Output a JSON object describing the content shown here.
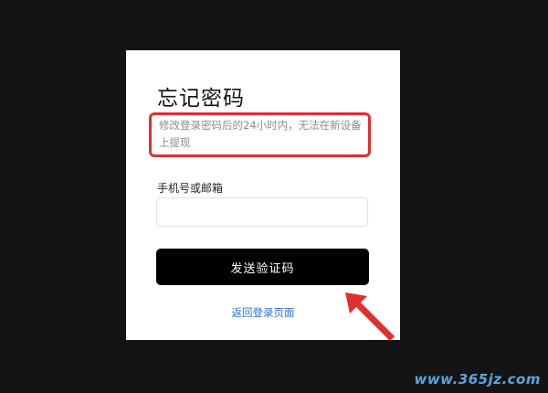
{
  "form": {
    "title": "忘记密码",
    "notice": "修改登录密码后的24小时内，无法在新设备上提现",
    "field_label": "手机号或邮箱",
    "field_value": "",
    "field_placeholder": "",
    "send_button_label": "发送验证码",
    "back_link_label": "返回登录页面"
  },
  "annotations": {
    "highlight_color": "#e0302e",
    "arrow_color": "#e0302e"
  },
  "watermark": {
    "text": "www.365jz.com"
  },
  "colors": {
    "background": "#141414",
    "card": "#ffffff",
    "button": "#000000",
    "link": "#2f6fd8"
  }
}
